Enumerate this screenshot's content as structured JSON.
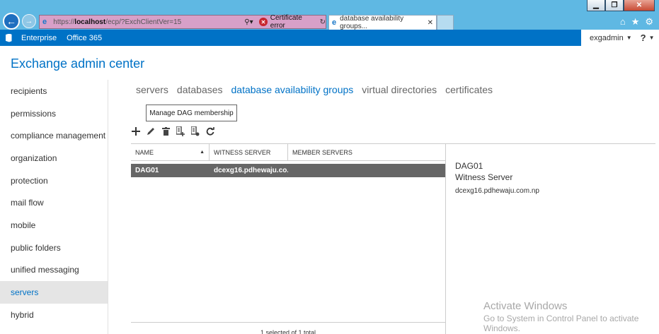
{
  "browser": {
    "url_prefix": "https://",
    "url_host": "localhost",
    "url_path": "/ecp/?ExchClientVer=15",
    "cert_error": "Certificate error",
    "tab_title": "database availability groups..."
  },
  "topbar": {
    "links": [
      "Enterprise",
      "Office 365"
    ],
    "user": "exgadmin",
    "help": "?"
  },
  "app": {
    "title": "Exchange admin center"
  },
  "nav": {
    "items": [
      "recipients",
      "permissions",
      "compliance management",
      "organization",
      "protection",
      "mail flow",
      "mobile",
      "public folders",
      "unified messaging",
      "servers",
      "hybrid"
    ],
    "active": "servers"
  },
  "subtabs": {
    "items": [
      "servers",
      "databases",
      "database availability groups",
      "virtual directories",
      "certificates"
    ],
    "active": "database availability groups"
  },
  "tooltip": {
    "text": "Manage DAG membership"
  },
  "grid": {
    "columns": [
      "NAME",
      "WITNESS SERVER",
      "MEMBER SERVERS"
    ],
    "rows": [
      {
        "name": "DAG01",
        "witness": "dcexg16.pdhewaju.co...",
        "members": ""
      }
    ],
    "footer": "1 selected of 1 total"
  },
  "details": {
    "name": "DAG01",
    "label": "Witness Server",
    "value": "dcexg16.pdhewaju.com.np"
  },
  "watermark": {
    "title": "Activate Windows",
    "subtitle": "Go to System in Control Panel to activate Windows."
  },
  "colors": {
    "brand": "#0072c6",
    "selected_row": "#666666"
  }
}
